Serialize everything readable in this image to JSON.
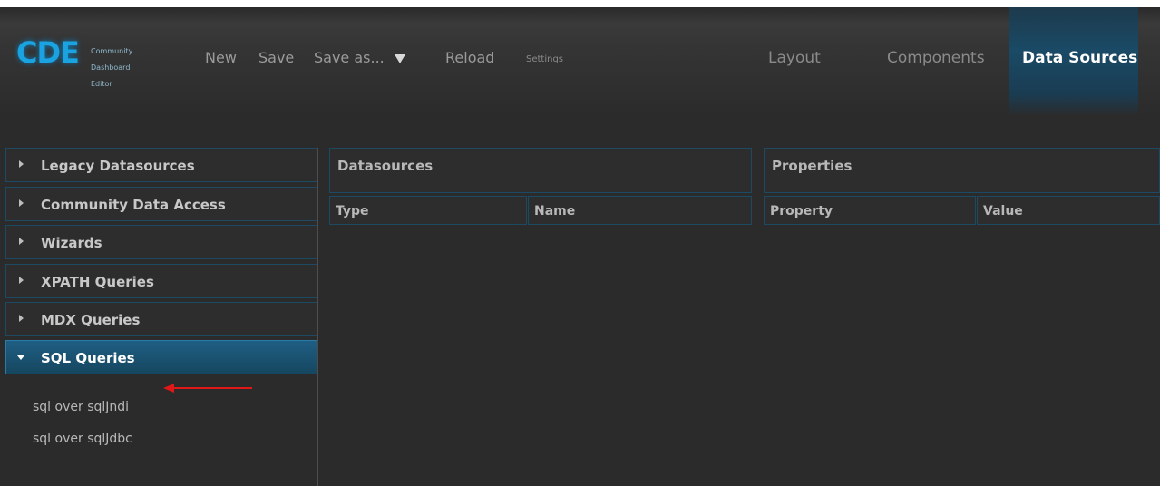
{
  "logo": {
    "mark": "CDE",
    "line1": "Community",
    "line2": "Dashboard",
    "line3": "Editor"
  },
  "menu": {
    "new": "New",
    "save": "Save",
    "save_as": "Save as...",
    "reload": "Reload",
    "settings": "Settings"
  },
  "tabs": {
    "layout": "Layout",
    "components": "Components",
    "data_sources": "Data Sources"
  },
  "sidebar": {
    "categories": [
      {
        "label": "Legacy Datasources"
      },
      {
        "label": "Community Data Access"
      },
      {
        "label": "Wizards"
      },
      {
        "label": "XPATH Queries"
      },
      {
        "label": "MDX Queries"
      },
      {
        "label": "SQL Queries"
      }
    ],
    "sql_items": [
      {
        "label": "sql over sqlJndi"
      },
      {
        "label": "sql over sqlJdbc"
      }
    ]
  },
  "datasources_panel": {
    "title": "Datasources",
    "col_type": "Type",
    "col_name": "Name"
  },
  "properties_panel": {
    "title": "Properties",
    "col_property": "Property",
    "col_value": "Value"
  },
  "colors": {
    "accent": "#1f5e84",
    "border": "#1d4a63",
    "annotation_arrow": "#e01818"
  }
}
